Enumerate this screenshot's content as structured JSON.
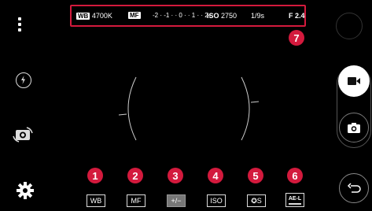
{
  "left_bar": {
    "menu_icon": "more-vertical-icon",
    "flash_icon": "flash-off-icon",
    "switch_icon": "switch-camera-icon",
    "settings_icon": "gear-icon"
  },
  "info_bar": {
    "wb_tag": "WB",
    "wb_value": "4700K",
    "mf_tag": "MF",
    "ev_scale": "-2 · -1 · · 0 · · 1 · · 2+",
    "iso_label": "ISO",
    "iso_value": "2750",
    "shutter": "1/9s",
    "aperture": "F 2.4",
    "badge": "7"
  },
  "controls": [
    {
      "badge": "1",
      "label": "WB"
    },
    {
      "badge": "2",
      "label": "MF"
    },
    {
      "badge": "3",
      "label": "+/−"
    },
    {
      "badge": "4",
      "label": "ISO"
    },
    {
      "badge": "5",
      "label": "S"
    },
    {
      "badge": "6",
      "label": "AE-L"
    }
  ],
  "right_bar": {
    "video_icon": "video-camera-icon",
    "photo_icon": "camera-icon",
    "back_icon": "back-arrow-icon"
  },
  "colors": {
    "accent": "#d31a3d",
    "background": "#000000"
  }
}
